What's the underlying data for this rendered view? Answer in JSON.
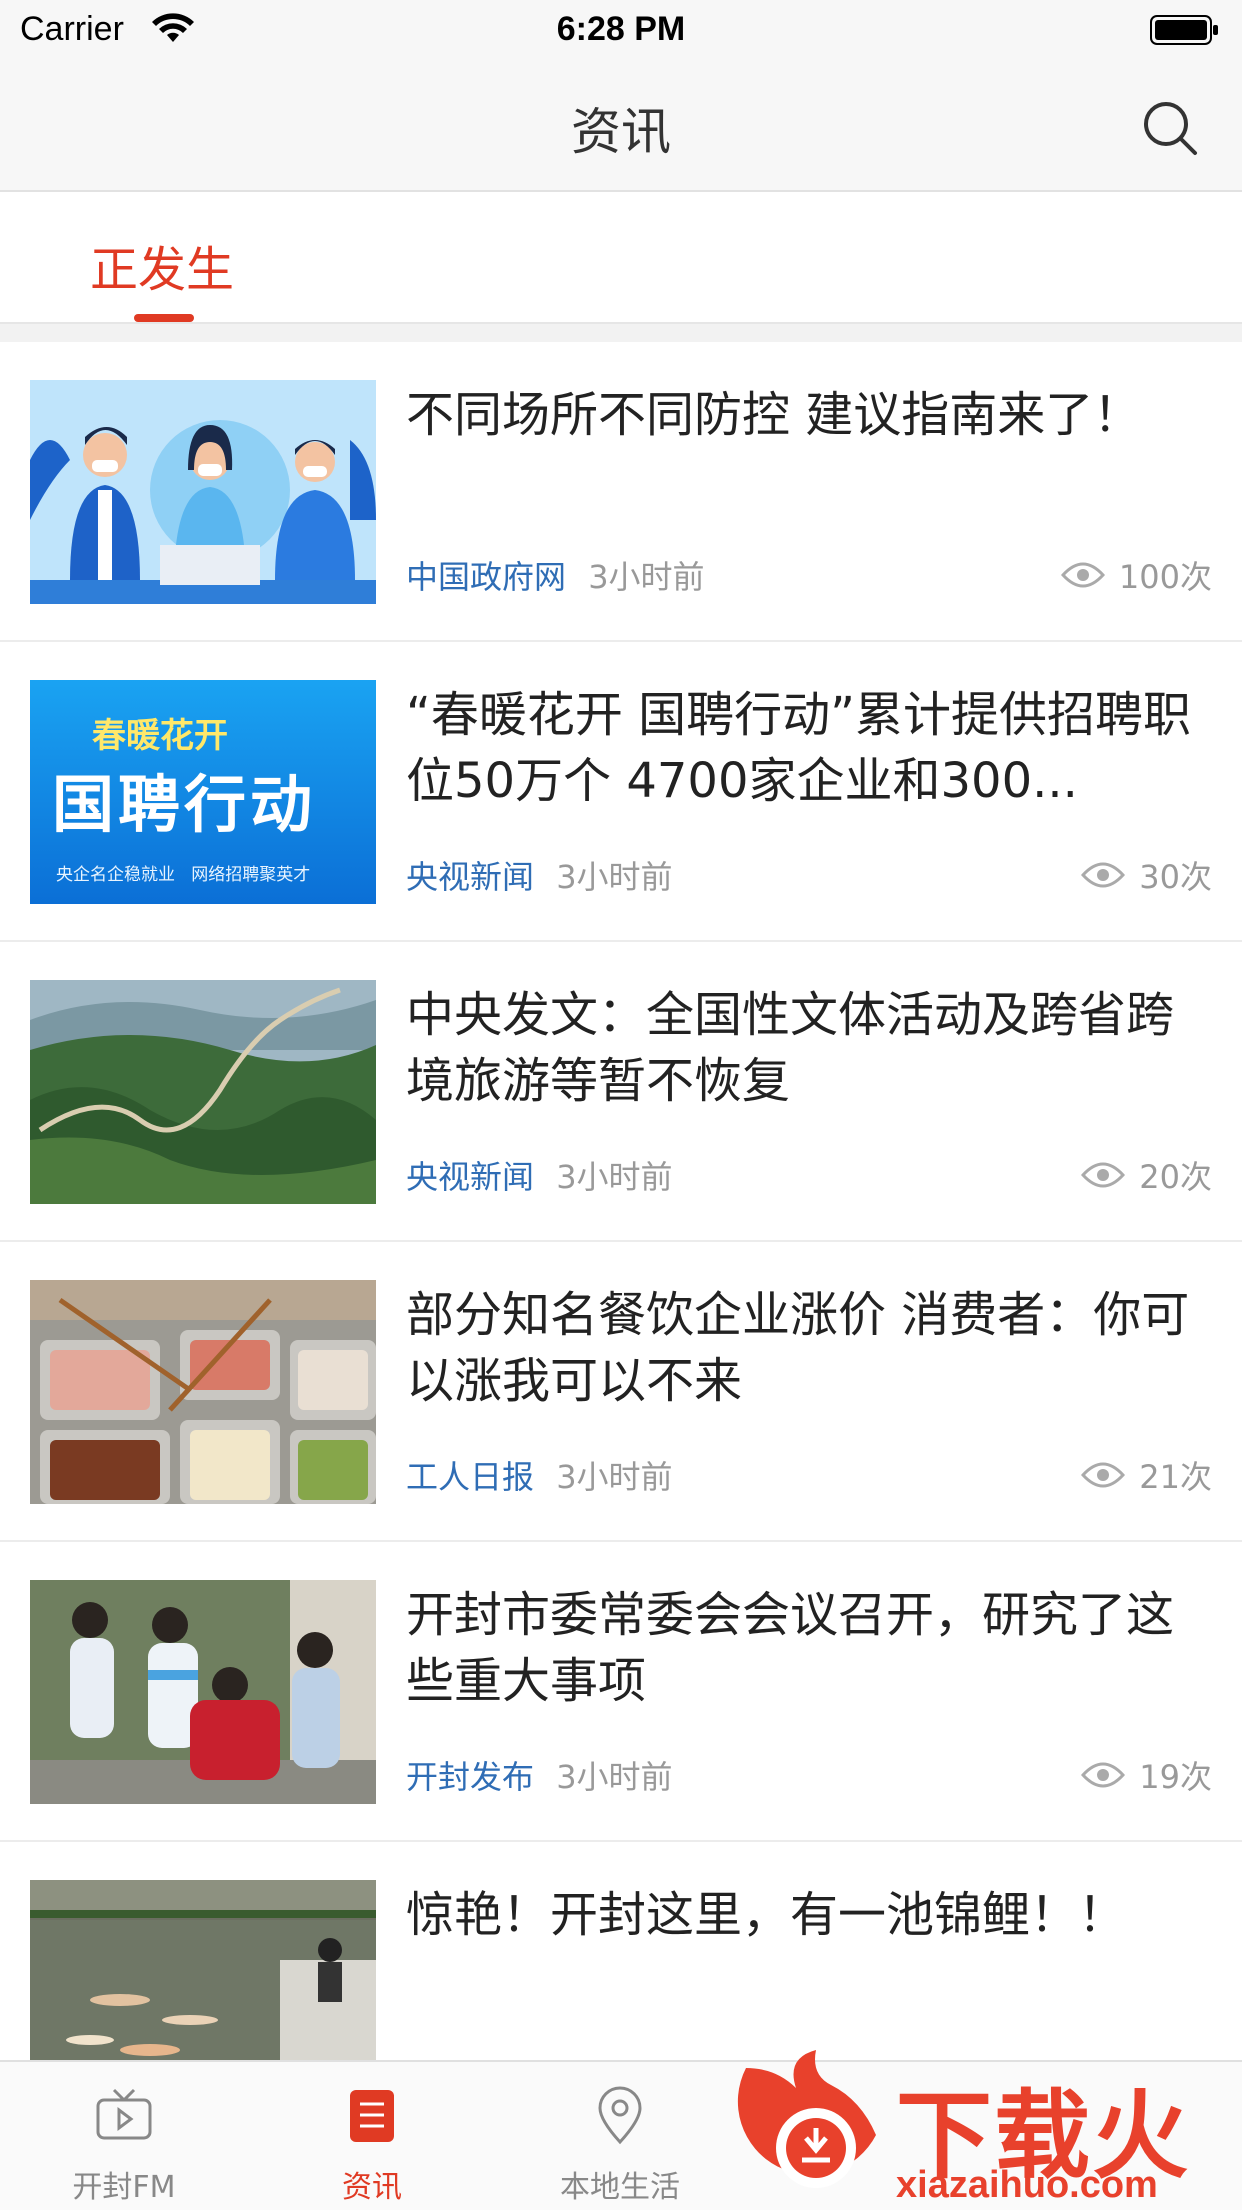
{
  "status_bar": {
    "carrier": "Carrier",
    "time": "6:28 PM"
  },
  "nav": {
    "title": "资讯"
  },
  "topic_tabs": [
    {
      "label": "正发生",
      "active": true
    }
  ],
  "news": [
    {
      "title": "不同场所不同防控 建议指南来了！",
      "source": "中国政府网",
      "time": "3小时前",
      "views": "100次"
    },
    {
      "title": "“春暖花开 国聘行动”累计提供招聘职位50万个 4700家企业和300...",
      "source": "央视新闻",
      "time": "3小时前",
      "views": "30次",
      "thumb_text": {
        "top": "春暖花开",
        "main": "国聘行动",
        "bottom": "央企名企稳就业   网络招聘聚英才"
      }
    },
    {
      "title": "中央发文：全国性文体活动及跨省跨境旅游等暂不恢复",
      "source": "央视新闻",
      "time": "3小时前",
      "views": "20次"
    },
    {
      "title": "部分知名餐饮企业涨价 消费者：你可以涨我可以不来",
      "source": "工人日报",
      "time": "3小时前",
      "views": "21次"
    },
    {
      "title": "开封市委常委会会议召开，研究了这些重大事项",
      "source": "开封发布",
      "time": "3小时前",
      "views": "19次"
    },
    {
      "title": "惊艳！开封这里，有一池锦鲤！！",
      "source": "",
      "time": "",
      "views": ""
    }
  ],
  "tabbar": {
    "items": [
      {
        "label": "开封FM",
        "icon": "tv-play-icon",
        "active": false
      },
      {
        "label": "资讯",
        "icon": "news-list-icon",
        "active": true
      },
      {
        "label": "本地生活",
        "icon": "location-pin-icon",
        "active": false
      }
    ]
  },
  "watermark": {
    "text": "下载火",
    "url": "xiazaihuo.com"
  },
  "colors": {
    "accent": "#e03a23",
    "source_blue": "#2f6db5",
    "meta_gray": "#999999"
  }
}
